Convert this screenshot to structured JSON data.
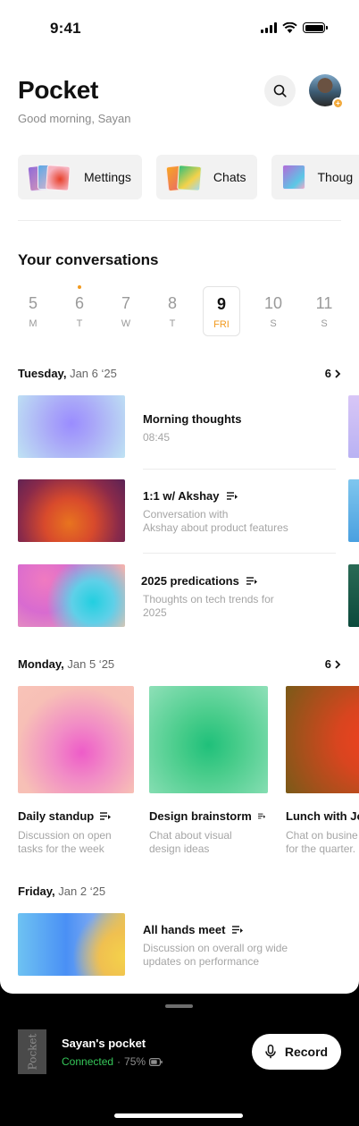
{
  "status_bar": {
    "time": "9:41"
  },
  "header": {
    "title": "Pocket",
    "greeting": "Good morning, Sayan"
  },
  "categories": [
    {
      "label": "Mettings"
    },
    {
      "label": "Chats"
    },
    {
      "label": "Thoug"
    }
  ],
  "conversations": {
    "title": "Your conversations",
    "days": [
      {
        "num": "5",
        "dow": "M"
      },
      {
        "num": "6",
        "dow": "T",
        "has_dot": true
      },
      {
        "num": "7",
        "dow": "W"
      },
      {
        "num": "8",
        "dow": "T"
      },
      {
        "num": "9",
        "dow": "FRI",
        "selected": true
      },
      {
        "num": "10",
        "dow": "S"
      },
      {
        "num": "11",
        "dow": "S"
      }
    ]
  },
  "groups": [
    {
      "day": "Tuesday,",
      "date": "Jan 6 ‘25",
      "count": "6",
      "items": [
        {
          "title": "Morning thoughts",
          "sub": "08:45",
          "has_list_icon": false
        },
        {
          "title": "1:1 w/ Akshay",
          "sub1": "Conversation with",
          "sub2": "Akshay about product features",
          "has_list_icon": true
        },
        {
          "title": "2025 predications",
          "sub1": "Thoughts on tech trends for",
          "sub2": "2025",
          "has_list_icon": true
        }
      ]
    },
    {
      "day": "Monday,",
      "date": "Jan 5 ‘25",
      "count": "6",
      "cards": [
        {
          "title": "Daily standup",
          "sub1": "Discussion on open",
          "sub2": "tasks for the week"
        },
        {
          "title": "Design brainstorm",
          "sub1": "Chat about visual",
          "sub2": "design ideas"
        },
        {
          "title": "Lunch with Jo",
          "sub1": "Chat on busine",
          "sub2": "for the quarter."
        }
      ]
    },
    {
      "day": "Friday,",
      "date": "Jan 2 ‘25",
      "items": [
        {
          "title": "All hands meet",
          "sub1": "Discussion on overall org wide",
          "sub2": "updates on performance",
          "has_list_icon": true
        }
      ]
    }
  ],
  "device": {
    "label": "Pocket",
    "name": "Sayan's pocket",
    "status": "Connected",
    "separator": "·",
    "battery": "75%",
    "record_label": "Record"
  },
  "colors": {
    "accent": "#f29a1e",
    "connected": "#35c759"
  }
}
